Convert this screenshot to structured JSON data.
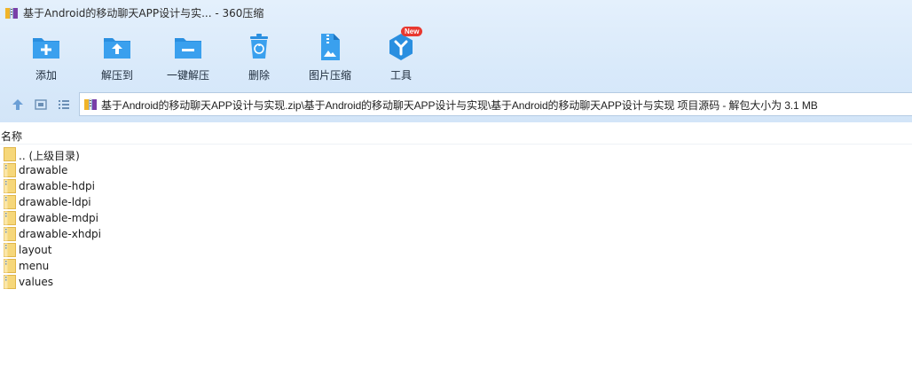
{
  "window": {
    "title": "基于Android的移动聊天APP设计与实... - 360压缩"
  },
  "toolbar": {
    "items": [
      {
        "label": "添加",
        "icon": "add-icon"
      },
      {
        "label": "解压到",
        "icon": "extract-to-icon"
      },
      {
        "label": "一键解压",
        "icon": "one-click-extract-icon"
      },
      {
        "label": "删除",
        "icon": "delete-icon"
      },
      {
        "label": "图片压缩",
        "icon": "image-compress-icon"
      },
      {
        "label": "工具",
        "icon": "tools-icon",
        "badge": "New"
      }
    ]
  },
  "address": {
    "path": "基于Android的移动聊天APP设计与实现.zip\\基于Android的移动聊天APP设计与实现\\基于Android的移动聊天APP设计与实现 项目源码 - 解包大小为 3.1 MB"
  },
  "list": {
    "column_name": "名称",
    "items": [
      {
        "name": ".. (上级目录)"
      },
      {
        "name": "drawable"
      },
      {
        "name": "drawable-hdpi"
      },
      {
        "name": "drawable-ldpi"
      },
      {
        "name": "drawable-mdpi"
      },
      {
        "name": "drawable-xhdpi"
      },
      {
        "name": "layout"
      },
      {
        "name": "menu"
      },
      {
        "name": "values"
      }
    ]
  },
  "colors": {
    "accent": "#2a8fe0",
    "folder": "#f6d77a",
    "badge": "#e8382f"
  }
}
